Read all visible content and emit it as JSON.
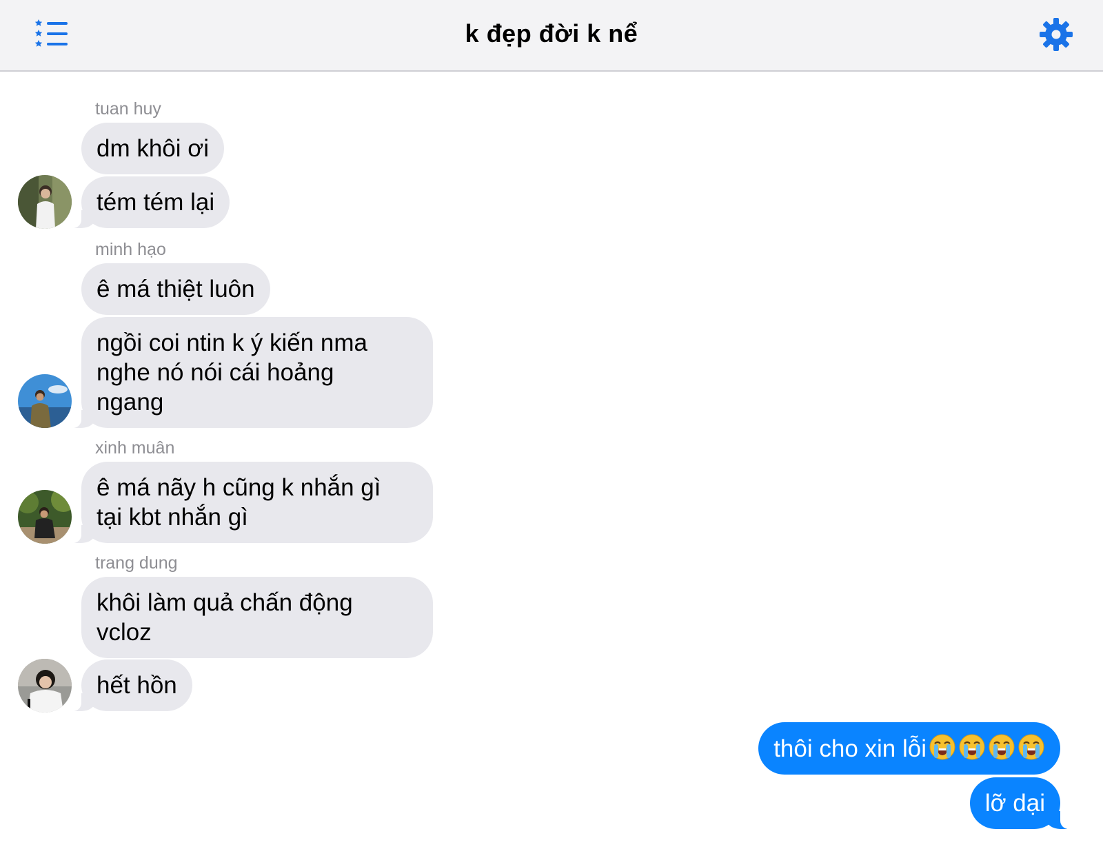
{
  "header": {
    "title": "k đẹp đời k nể",
    "menu_icon": "list-icon",
    "settings_icon": "gear-icon",
    "accent_color": "#0a84ff"
  },
  "messages": [
    {
      "sender": "tuan huy",
      "bubbles": [
        "dm khôi ơi",
        "tém tém lại"
      ]
    },
    {
      "sender": "minh hạo",
      "bubbles": [
        "ê má thiệt luôn",
        "ngồi coi ntin k ý kiến nma\nnghe nó nói cái hoảng\nngang"
      ]
    },
    {
      "sender": "xinh muân",
      "bubbles": [
        "ê má nãy h cũng k nhắn gì\ntại kbt nhắn gì"
      ]
    },
    {
      "sender": "trang dung",
      "bubbles": [
        "khôi làm quả chấn động\nvcloz",
        "hết hồn"
      ]
    }
  ],
  "outgoing": [
    {
      "text": "thôi cho xin lỗi",
      "emoji": "loudly-crying-face",
      "emoji_count": 4
    },
    {
      "text": "lỡ dại"
    }
  ]
}
